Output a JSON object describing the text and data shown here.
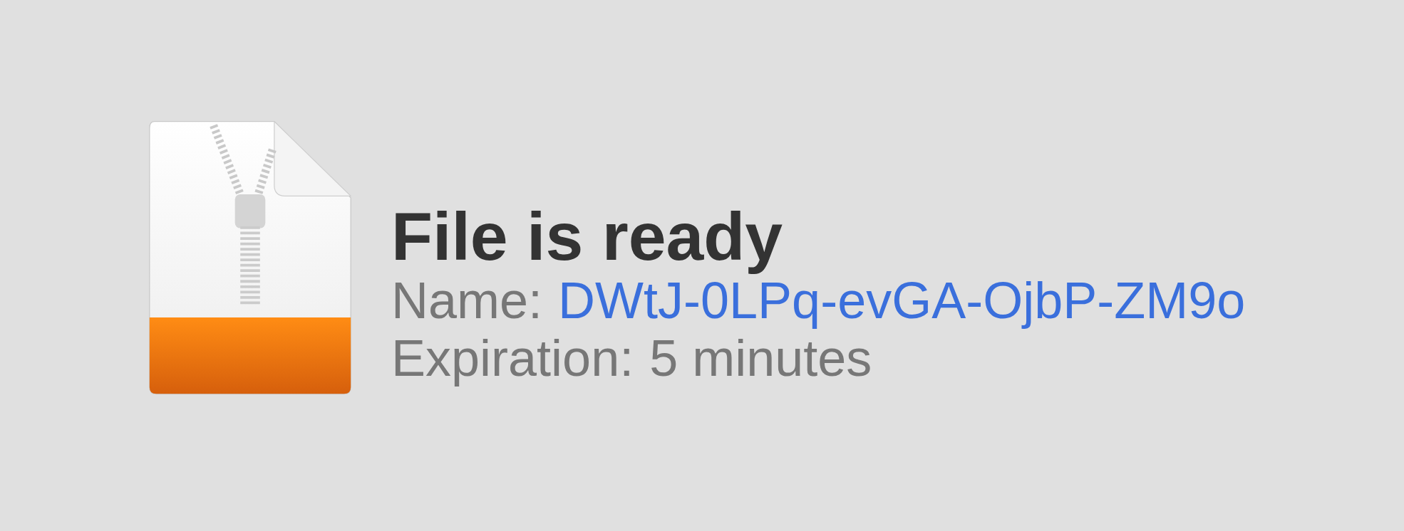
{
  "title": "File is ready",
  "fields": [
    {
      "label": "Name:",
      "value": "DWtJ-0LPq-evGA-OjbP-ZM9o",
      "kind": "link"
    },
    {
      "label": "Expiration:",
      "value": "5 minutes",
      "kind": "text"
    }
  ]
}
